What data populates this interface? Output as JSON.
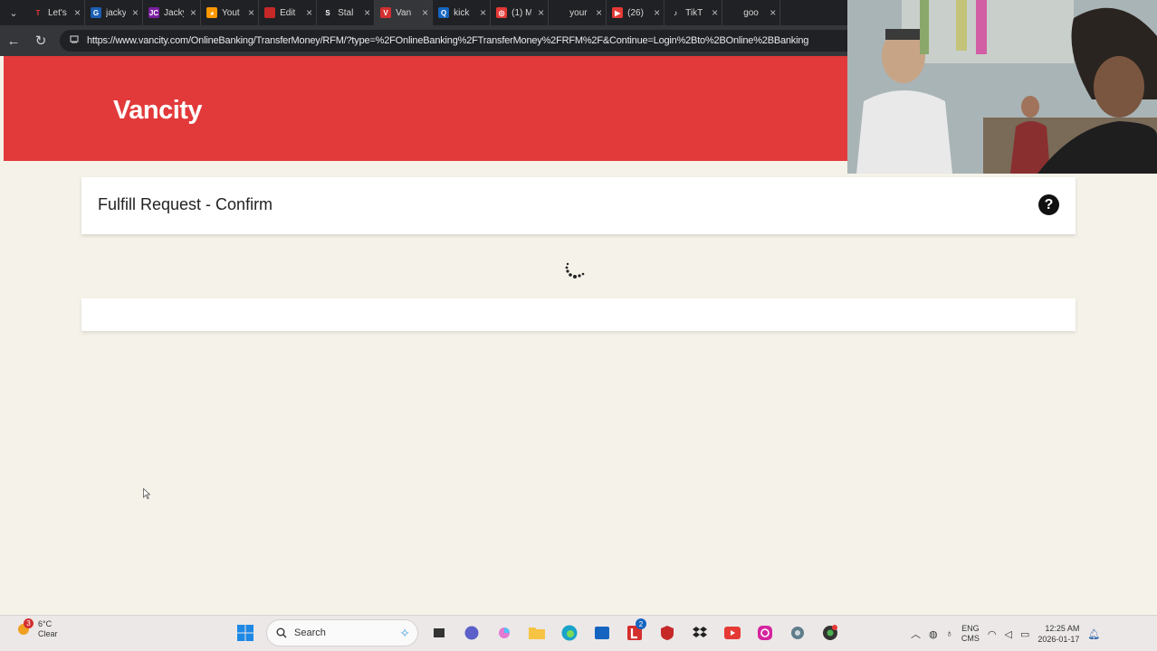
{
  "browser": {
    "tabs": [
      {
        "title": "Let's",
        "fav_color": "#202124",
        "fav_text": "T",
        "fav_text_color": "#e2393a"
      },
      {
        "title": "jacky",
        "fav_color": "#1a5fb4",
        "fav_text": "G"
      },
      {
        "title": "Jacky",
        "fav_color": "#7b1fa2",
        "fav_text": "JC"
      },
      {
        "title": "Yout",
        "fav_color": "#ff9800",
        "fav_text": "◕"
      },
      {
        "title": "Edit",
        "fav_color": "#c62828",
        "fav_text": ""
      },
      {
        "title": "Stal",
        "fav_color": "#202124",
        "fav_text": "S"
      },
      {
        "title": "Van",
        "fav_color": "#d32f2f",
        "fav_text": "V",
        "active": true
      },
      {
        "title": "kick",
        "fav_color": "#1565c0",
        "fav_text": "Q"
      },
      {
        "title": "(1) M",
        "fav_color": "#e53935",
        "fav_text": "◎"
      },
      {
        "title": "your",
        "fav_color": "#202124",
        "fav_text": ""
      },
      {
        "title": "(26)",
        "fav_color": "#e53935",
        "fav_text": "▶"
      },
      {
        "title": "TikT",
        "fav_color": "#202124",
        "fav_text": "♪"
      },
      {
        "title": "goo",
        "fav_color": "#202124",
        "fav_text": ""
      }
    ],
    "url": "https://www.vancity.com/OnlineBanking/TransferMoney/RFM/?type=%2FOnlineBanking%2FTransferMoney%2FRFM%2F&Continue=Login%2Bto%2BOnline%2BBanking"
  },
  "page": {
    "brand": "Vancity",
    "brand_color": "#e2393a",
    "card_title": "Fulfill Request - Confirm"
  },
  "taskbar": {
    "weather_temp": "6°C",
    "weather_desc": "Clear",
    "weather_badge": "3",
    "search_label": "Search",
    "lang_top": "ENG",
    "lang_bottom": "CMS",
    "time": "12:25 AM",
    "date": "2026-01-17",
    "badge_count": "2"
  }
}
